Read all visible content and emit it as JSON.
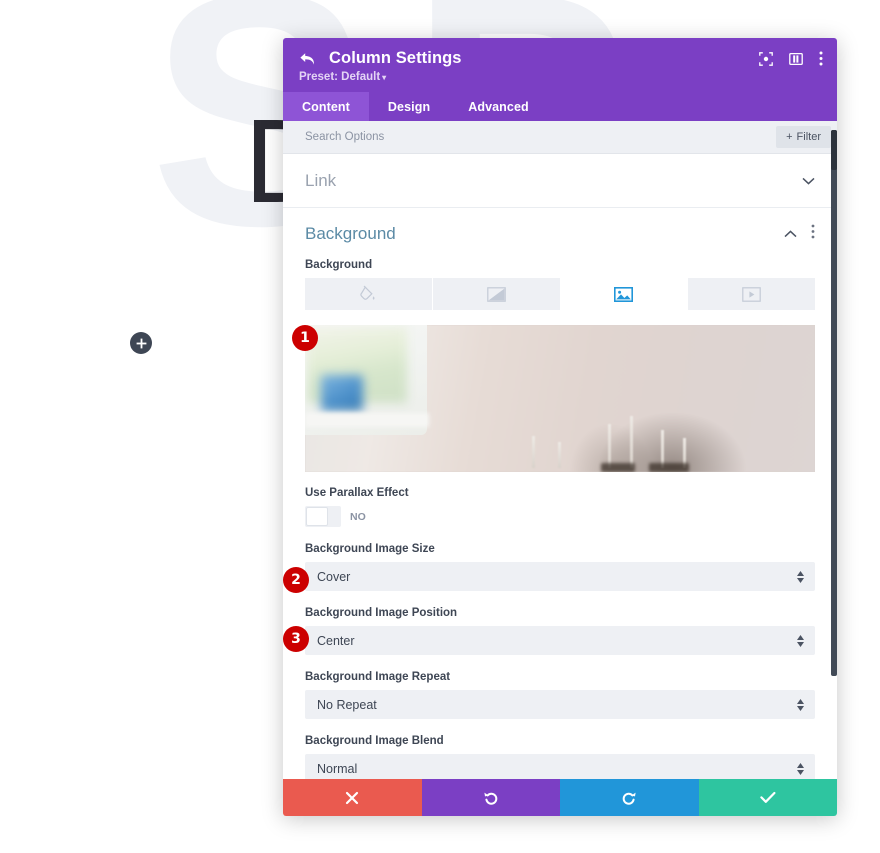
{
  "background_page": {
    "watermark_text": "SP",
    "headline_text": "Dia",
    "add_button_icon": "plus-icon"
  },
  "modal": {
    "header": {
      "back_icon": "back-arrow-icon",
      "title": "Column Settings",
      "preset_label": "Preset: Default",
      "preset_caret": "▾",
      "icons": [
        {
          "name": "expand-icon",
          "label": "Expand"
        },
        {
          "name": "layout-panel-icon",
          "label": "Layout"
        },
        {
          "name": "more-vertical-icon",
          "label": "More options"
        }
      ]
    },
    "tabs": [
      {
        "label": "Content",
        "active": true
      },
      {
        "label": "Design",
        "active": false
      },
      {
        "label": "Advanced",
        "active": false
      }
    ],
    "search": {
      "placeholder": "Search Options",
      "value": "",
      "filter_label": "Filter",
      "filter_plus": "+"
    },
    "sections": {
      "link": {
        "label": "Link",
        "chevron_icon": "chevron-down-icon",
        "expanded": false
      },
      "background": {
        "label": "Background",
        "chevron_icon": "chevron-up-icon",
        "more_icon": "more-vertical-icon",
        "expanded": true,
        "background_field_label": "Background",
        "bg_types": [
          {
            "name": "bg-color-tab",
            "icon": "paint-bucket-icon",
            "active": false
          },
          {
            "name": "bg-gradient-tab",
            "icon": "gradient-icon",
            "active": false
          },
          {
            "name": "bg-image-tab",
            "icon": "image-icon",
            "active": true
          },
          {
            "name": "bg-video-tab",
            "icon": "video-icon",
            "active": false
          }
        ],
        "image_preview_alt": "background-image-preview",
        "parallax": {
          "label": "Use Parallax Effect",
          "value": "NO",
          "enabled": false
        },
        "fields": [
          {
            "label": "Background Image Size",
            "value": "Cover",
            "name": "background-image-size-select",
            "badge": "2"
          },
          {
            "label": "Background Image Position",
            "value": "Center",
            "name": "background-image-position-select",
            "badge": "3"
          },
          {
            "label": "Background Image Repeat",
            "value": "No Repeat",
            "name": "background-image-repeat-select",
            "badge": ""
          },
          {
            "label": "Background Image Blend",
            "value": "Normal",
            "name": "background-image-blend-select",
            "badge": ""
          }
        ]
      }
    },
    "footer": [
      {
        "name": "cancel-button",
        "icon": "close-icon",
        "color": "#ea5a4f"
      },
      {
        "name": "undo-button",
        "icon": "undo-icon",
        "color": "#7b3fc4"
      },
      {
        "name": "redo-button",
        "icon": "redo-icon",
        "color": "#2196d9"
      },
      {
        "name": "save-button",
        "icon": "check-icon",
        "color": "#2ec5a0"
      }
    ]
  },
  "annotations": {
    "badge_1": "1",
    "badge_2": "2",
    "badge_3": "3"
  },
  "colors": {
    "header_purple": "#7b3fc4",
    "tab_active_purple": "#8e54d6",
    "badge_red": "#cc0000",
    "accent_blue": "#2196d9",
    "save_green": "#2ec5a0",
    "cancel_red": "#ea5a4f"
  }
}
